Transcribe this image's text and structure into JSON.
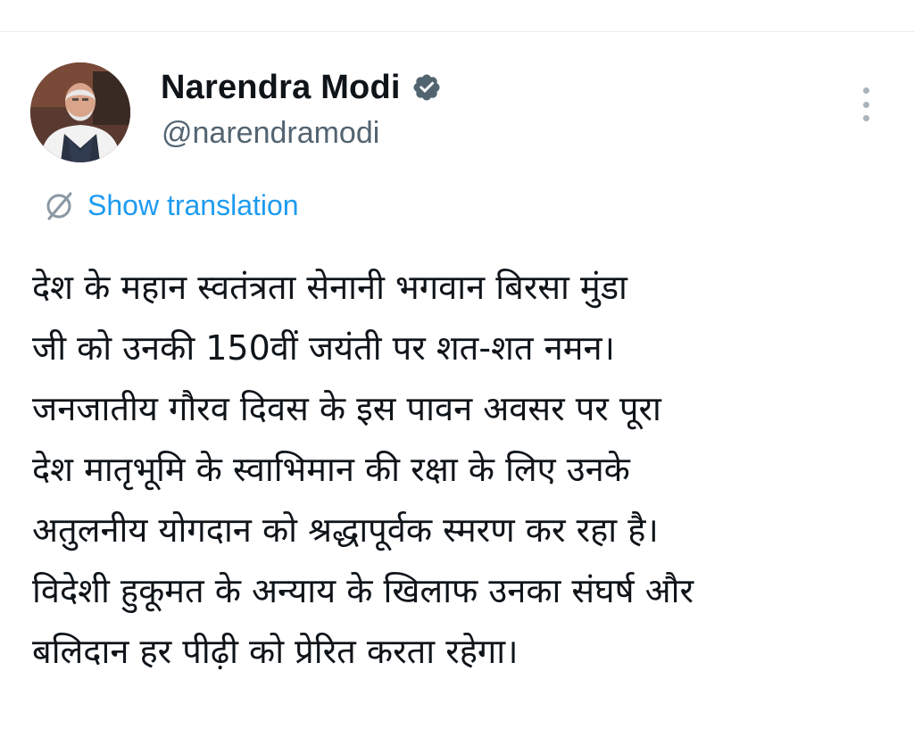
{
  "author": {
    "name": "Narendra Modi",
    "handle": "@narendramodi",
    "verified_icon": "verified-badge-icon",
    "avatar_icon": "profile-photo"
  },
  "translation": {
    "label": "Show translation",
    "icon": "translate-icon"
  },
  "menu": {
    "icon": "vertical-ellipsis-icon"
  },
  "tweet": {
    "lines": [
      "देश के महान स्वतंत्रता सेनानी भगवान बिरसा मुंडा",
      "जी को उनकी 150वीं जयंती पर शत-शत नमन।",
      "जनजातीय गौरव दिवस के इस पावन अवसर पर पूरा",
      "देश मातृभूमि के स्वाभिमान की रक्षा के लिए उनके",
      "अतुलनीय योगदान को श्रद्धापूर्वक स्मरण कर रहा है।",
      "विदेशी हुकूमत के अन्याय के खिलाफ उनका संघर्ष और",
      "बलिदान हर पीढ़ी को प्रेरित करता रहेगा।"
    ]
  },
  "colors": {
    "accent": "#1d9bf0",
    "handle": "#536471",
    "text": "#0f1419",
    "badge": "#536471"
  }
}
